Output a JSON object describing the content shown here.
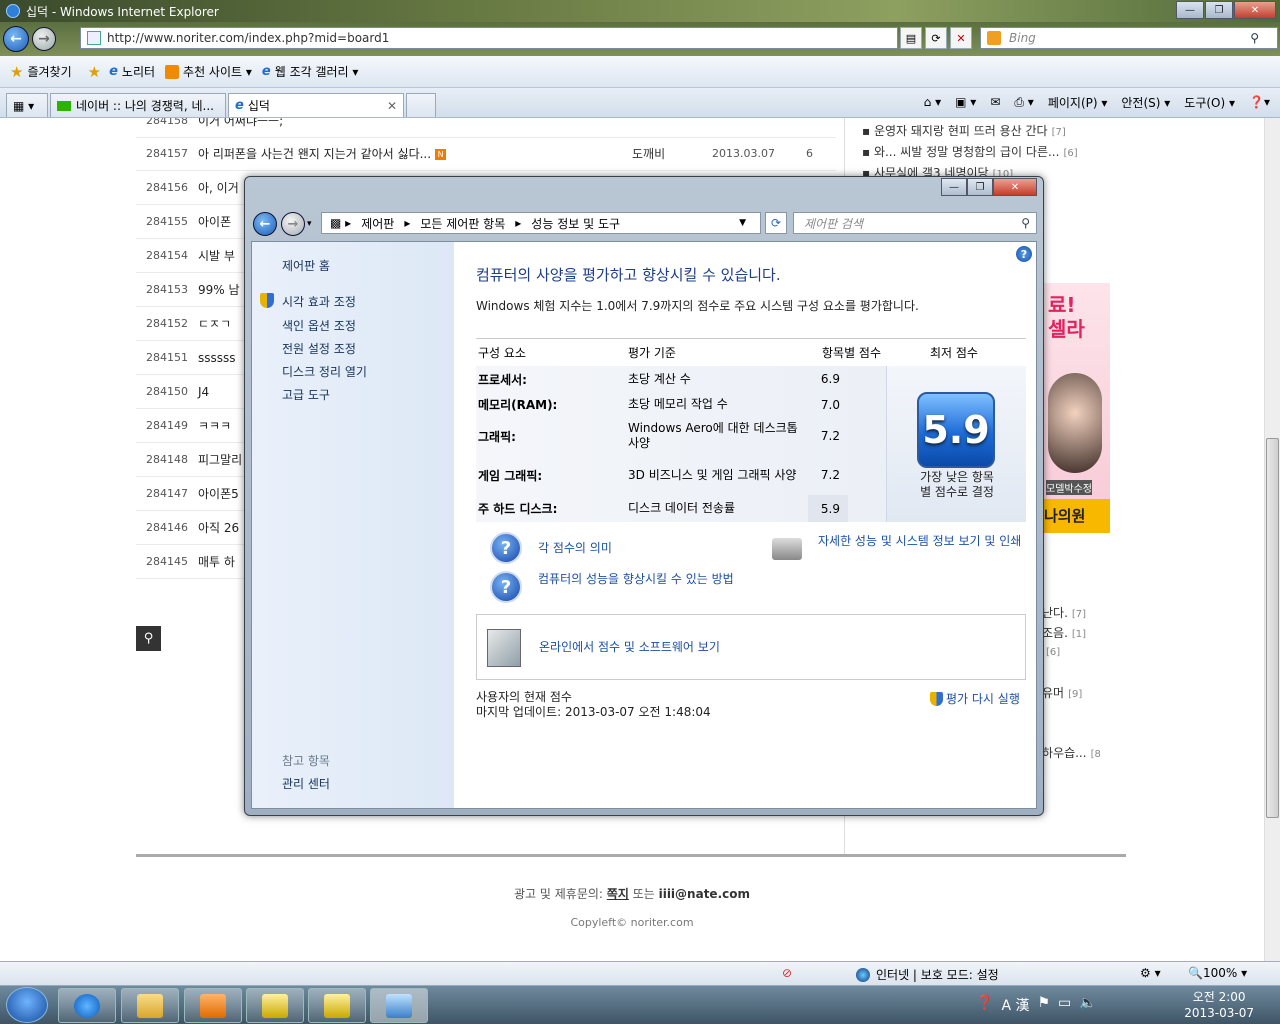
{
  "ie": {
    "title": "십덕 - Windows Internet Explorer",
    "url": "http://www.noriter.com/index.php?mid=board1",
    "search_placeholder": "Bing",
    "favorites_label": "즐겨찾기",
    "fav_items": [
      "노리터",
      "추천 사이트 ▾",
      "웹 조각 갤러리 ▾"
    ],
    "tabs": [
      "네이버 :: 나의 경쟁력, 네...",
      "십덕"
    ],
    "cmd_items": [
      "페이지(P) ▾",
      "안전(S) ▾",
      "도구(O) ▾"
    ],
    "status_zone": "인터넷 | 보호 모드: 설정",
    "zoom": "100%"
  },
  "board": {
    "partial_top_title": "이거 어쩌냐ㅡㅡ;",
    "rows": [
      {
        "no": "284157",
        "title": "아 리퍼폰을 사는건 왠지 지는거 같아서 싫다...",
        "author": "도깨비",
        "date": "2013.03.07",
        "views": "6"
      },
      {
        "no": "284156",
        "title": "아, 이거",
        "author": "",
        "date": "",
        "views": ""
      },
      {
        "no": "284155",
        "title": "아이폰",
        "author": "",
        "date": "",
        "views": ""
      },
      {
        "no": "284154",
        "title": "시발 부",
        "author": "",
        "date": "",
        "views": ""
      },
      {
        "no": "284153",
        "title": "99% 남",
        "author": "",
        "date": "",
        "views": ""
      },
      {
        "no": "284152",
        "title": "ㄷㅈㄱ",
        "author": "",
        "date": "",
        "views": ""
      },
      {
        "no": "284151",
        "title": "ssssss",
        "author": "",
        "date": "",
        "views": ""
      },
      {
        "no": "284150",
        "title": "J4",
        "author": "",
        "date": "",
        "views": ""
      },
      {
        "no": "284149",
        "title": "ㅋㅋㅋ",
        "author": "",
        "date": "",
        "views": ""
      },
      {
        "no": "284148",
        "title": "피그말리",
        "author": "",
        "date": "",
        "views": ""
      },
      {
        "no": "284147",
        "title": "아이폰5",
        "author": "",
        "date": "",
        "views": ""
      },
      {
        "no": "284146",
        "title": "아직 26",
        "author": "",
        "date": "",
        "views": ""
      },
      {
        "no": "284145",
        "title": "매투 하",
        "author": "",
        "date": "",
        "views": ""
      }
    ],
    "side_top": [
      {
        "text": "운영자 돼지랑 현피 뜨러 용산 간다",
        "count": "[7]"
      },
      {
        "text": "와... 씨발 정말 명청함의 급이 다른...",
        "count": "[6]"
      },
      {
        "text": "사무실에 갤3 네명이당",
        "count": "[10]"
      }
    ],
    "side_bottom": [
      {
        "text": "난다.",
        "count": "[7]"
      },
      {
        "text": "조음.",
        "count": "[1]"
      },
      {
        "text": "",
        "count": "[6]"
      },
      {
        "text": "유머",
        "count": "[9]"
      },
      {
        "text": "하우습...",
        "count": "[8"
      }
    ],
    "ad_text": "료!\n셀라",
    "ad_model": "모델박수정",
    "ad_bottom": "나의원",
    "footer_line1_a": "광고 및 제휴문의: ",
    "footer_line1_b": "쪽지",
    "footer_line1_c": " 또는 ",
    "footer_line1_d": "iiii@nate.com",
    "footer_line2": "Copyleft© noriter.com"
  },
  "cp": {
    "breadcrumb": [
      "제어판",
      "모든 제어판 항목",
      "성능 정보 및 도구"
    ],
    "search_placeholder": "제어판 검색",
    "left_home": "제어판 홈",
    "left_links": [
      "시각 효과 조정",
      "색인 옵션 조정",
      "전원 설정 조정",
      "디스크 정리 열기",
      "고급 도구"
    ],
    "see_also_header": "참고 항목",
    "see_also_link": "관리 센터",
    "title": "컴퓨터의 사양을 평가하고 향상시킬 수 있습니다.",
    "subtitle": "Windows 체험 지수는 1.0에서 7.9까지의 점수로 주요 시스템 구성 요소를 평가합니다.",
    "col_headers": [
      "구성 요소",
      "평가 기준",
      "항목별 점수",
      "최저 점수"
    ],
    "components": [
      {
        "name": "프로세서:",
        "criterion": "초당 계산 수",
        "score": "6.9"
      },
      {
        "name": "메모리(RAM):",
        "criterion": "초당 메모리 작업 수",
        "score": "7.0"
      },
      {
        "name": "그래픽:",
        "criterion": "Windows Aero에 대한 데스크톱 사양",
        "score": "7.2"
      },
      {
        "name": "게임 그래픽:",
        "criterion": "3D 비즈니스 및 게임 그래픽 사양",
        "score": "7.2"
      },
      {
        "name": "주 하드 디스크:",
        "criterion": "디스크 데이터 전송률",
        "score": "5.9"
      }
    ],
    "base_score": "5.9",
    "base_caption": "가장 낮은 항목\n별 점수로 결정",
    "link_meaning": "각 점수의 의미",
    "link_improve": "컴퓨터의 성능을 향상시킬 수 있는 방법",
    "link_details": "자세한 성능 및 시스템 정보 보기 및 인쇄",
    "link_online": "온라인에서 점수 및 소프트웨어 보기",
    "current_score_label": "사용자의 현재 점수",
    "last_update": "마지막 업데이트: 2013-03-07 오전 1:48:04",
    "rerun": "평가 다시 실행"
  },
  "taskbar": {
    "clock_time": "오전 2:00",
    "clock_date": "2013-03-07",
    "tray": "A 漢"
  }
}
